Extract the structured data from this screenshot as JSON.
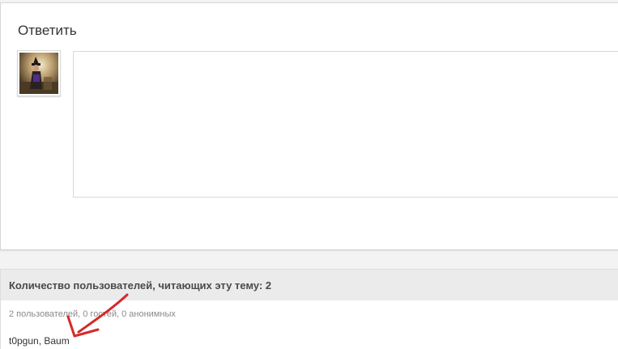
{
  "reply": {
    "title": "Ответить",
    "textarea_value": ""
  },
  "viewers": {
    "title": "Количество пользователей, читающих эту тему: 2",
    "stats": "2 пользователей, 0 гостей, 0 анонимных",
    "names": [
      "t0pgun",
      "Baum"
    ],
    "separator": ", "
  },
  "colors": {
    "annotation_arrow": "#d42a2a",
    "header_background": "#ebebeb",
    "page_background": "#f3f3f3"
  },
  "icons": {
    "avatar": "user-avatar-image",
    "annotation": "red-arrow-annotation"
  }
}
